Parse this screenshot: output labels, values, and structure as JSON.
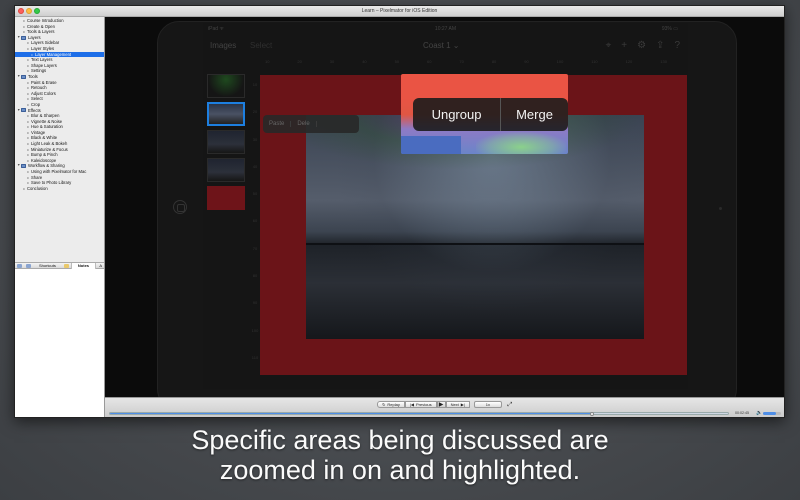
{
  "window": {
    "title": "Learn – Pixelmator for iOS Edition"
  },
  "sidebar": {
    "toc": [
      {
        "label": "Course Introduction",
        "level": "l0",
        "type": "item"
      },
      {
        "label": "Create & Open",
        "level": "l0",
        "type": "item"
      },
      {
        "label": "Tools & Layers",
        "level": "l0",
        "type": "item"
      },
      {
        "label": "Layers",
        "level": "section",
        "type": "section"
      },
      {
        "label": "Layers Sidebar",
        "level": "l1",
        "type": "item"
      },
      {
        "label": "Layer Styles",
        "level": "l1",
        "type": "item"
      },
      {
        "label": "Layer Management",
        "level": "l2",
        "type": "item",
        "selected": true
      },
      {
        "label": "Text Layers",
        "level": "l1",
        "type": "item"
      },
      {
        "label": "Shape Layers",
        "level": "l1",
        "type": "item"
      },
      {
        "label": "Settings",
        "level": "l1",
        "type": "item"
      },
      {
        "label": "Tools",
        "level": "section",
        "type": "section"
      },
      {
        "label": "Paint & Erase",
        "level": "l1",
        "type": "item"
      },
      {
        "label": "Retouch",
        "level": "l1",
        "type": "item"
      },
      {
        "label": "Adjust Colors",
        "level": "l1",
        "type": "item"
      },
      {
        "label": "Select",
        "level": "l1",
        "type": "item"
      },
      {
        "label": "Crop",
        "level": "l1",
        "type": "item"
      },
      {
        "label": "Effects",
        "level": "section",
        "type": "section"
      },
      {
        "label": "Blur & Sharpen",
        "level": "l1",
        "type": "item"
      },
      {
        "label": "Vignette & Noise",
        "level": "l1",
        "type": "item"
      },
      {
        "label": "Hue & Saturation",
        "level": "l1",
        "type": "item"
      },
      {
        "label": "Vintage",
        "level": "l1",
        "type": "item"
      },
      {
        "label": "Black & White",
        "level": "l1",
        "type": "item"
      },
      {
        "label": "Light Leak & Bokeh",
        "level": "l1",
        "type": "item"
      },
      {
        "label": "Miniaturize & Focus",
        "level": "l1",
        "type": "item"
      },
      {
        "label": "Bump & Pinch",
        "level": "l1",
        "type": "item"
      },
      {
        "label": "Kaleidoscope",
        "level": "l1",
        "type": "item"
      },
      {
        "label": "Workflow & Sharing",
        "level": "section",
        "type": "section"
      },
      {
        "label": "Using with Pixelmator for Mac",
        "level": "l1",
        "type": "item"
      },
      {
        "label": "Share",
        "level": "l1",
        "type": "item"
      },
      {
        "label": "Save to Photo Library",
        "level": "l1",
        "type": "item"
      },
      {
        "label": "Conclusion",
        "level": "l0",
        "type": "item"
      }
    ],
    "tabs": {
      "shortcuts": "Shortcuts",
      "notes": "Notes",
      "font_button": "A"
    }
  },
  "ipad": {
    "status_left": "iPad ᯤ",
    "status_time": "10:27 AM",
    "status_right": "93% ▭",
    "nav_title": "Images",
    "nav_select": "Select",
    "doc_title": "Coast 1 ⌄",
    "nav_icons": [
      "brush-icon",
      "plus-icon",
      "gear-icon",
      "share-icon",
      "help-icon"
    ],
    "nav_glyphs": [
      "⌖",
      "+",
      "⚙",
      "⇪",
      "?"
    ],
    "context_menu": [
      "Paste",
      "Dele"
    ],
    "ruler_h": [
      "10",
      "20",
      "30",
      "40",
      "50",
      "60",
      "70",
      "80",
      "90",
      "100",
      "110",
      "120",
      "130"
    ],
    "ruler_v": [
      "10",
      "20",
      "30",
      "40",
      "50",
      "60",
      "70",
      "80",
      "90",
      "100",
      "110"
    ]
  },
  "zoom_highlight": {
    "menu_items": [
      "Ungroup",
      "Merge"
    ],
    "colors": {
      "accent_red": "#ea5444",
      "menu_bg": "#1c1c1c"
    }
  },
  "player": {
    "replay_label": "Replay",
    "previous_label": "Previous",
    "next_label": "Next",
    "rate_label": "1x",
    "play_glyph": "▶",
    "replay_glyph": "↻",
    "prev_glyph": "|◀",
    "next_glyph": "▶|",
    "fullscreen_glyph": "⤢",
    "timecode": "00:02:45",
    "progress": 0.78,
    "volume": 0.7
  },
  "caption": {
    "line1": "Specific areas being discussed are",
    "line2": "zoomed in on and highlighted."
  }
}
